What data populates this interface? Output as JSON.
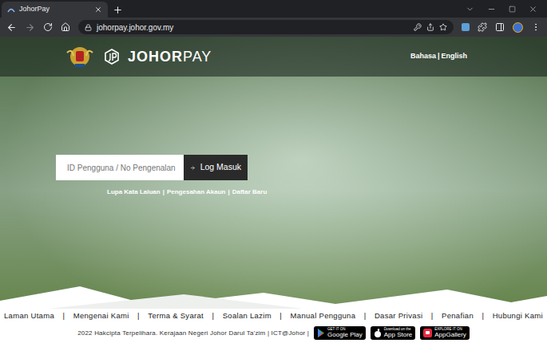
{
  "browser": {
    "tab": {
      "title": "JohorPay",
      "selected": true
    },
    "address": "johorpay.johor.gov.my"
  },
  "header": {
    "brand_bold": "JOHOR",
    "brand_light": "PAY",
    "languages": [
      "Bahasa",
      "English"
    ],
    "separator": "|"
  },
  "login": {
    "placeholder": "ID Pengguna / No Pengenalan",
    "button": "Log Masuk",
    "links": [
      "Lupa Kata Laluan",
      "Pengesahan Akaun",
      "Daftar Baru"
    ],
    "separator": "|"
  },
  "footer": {
    "links": [
      "Laman Utama",
      "Mengenai Kami",
      "Terma & Syarat",
      "Soalan Lazim",
      "Manual Pengguna",
      "Dasar Privasi",
      "Penafian",
      "Hubungi Kami"
    ],
    "separator": "|",
    "copyright": "2022 Hakcipta Terpelihara. Kerajaan Negeri Johor Darul Ta'zim | ICT@Johor |",
    "badges": [
      {
        "small": "GET IT ON",
        "name": "Google Play"
      },
      {
        "small": "Download on the",
        "name": "App Store"
      },
      {
        "small": "EXPLORE IT ON",
        "name": "AppGallery"
      }
    ]
  }
}
